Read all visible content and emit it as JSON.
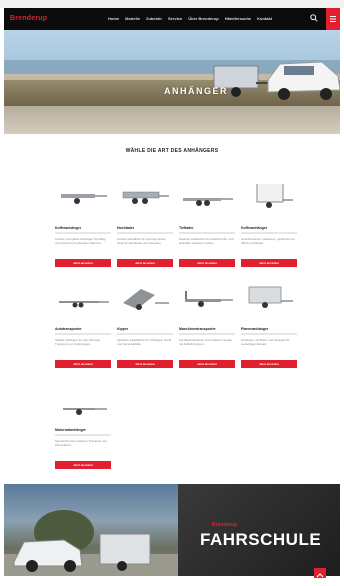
{
  "brand": {
    "name_white": "Brenderup",
    "accent": "#e0202e"
  },
  "nav": {
    "items": [
      "Home",
      "Modelle",
      "Zubehör",
      "Service",
      "Über Brenderup",
      "Händlersuche",
      "Kontakt"
    ]
  },
  "hero": {
    "title": "ANHÄNGER"
  },
  "section": {
    "title": "WÄHLE DIE ART DES ANHÄNGERS"
  },
  "cards": [
    {
      "title": "Kofferanhänger",
      "desc": "Leichte, kompakte Anhänger für Alltag und Freizeit mit robustem Rahmen.",
      "button": "Jetzt ansehen"
    },
    {
      "title": "Hochlader",
      "desc": "Große Ladefläche für sperrige Güter, ideal für Handwerk und Gewerbe.",
      "button": "Jetzt ansehen"
    },
    {
      "title": "Tieflader",
      "desc": "Niedrige Ladehöhe für einfaches Be- und Entladen schwerer Lasten.",
      "button": "Jetzt ansehen"
    },
    {
      "title": "Kofferanhänger",
      "desc": "Geschlossener Laderaum, geschützt vor Wind und Wetter.",
      "button": "Jetzt ansehen"
    },
    {
      "title": "Autotransporter",
      "desc": "Stabile Anhänger für den sicheren Transport von Fahrzeugen.",
      "button": "Jetzt ansehen"
    },
    {
      "title": "Kipper",
      "desc": "Kippbare Ladefläche für Schüttgut, Sand und Gartenabfälle.",
      "button": "Jetzt ansehen"
    },
    {
      "title": "Maschinentransporter",
      "desc": "Für Baumaschinen und schwere Geräte mit Auffahrrampen.",
      "button": "Jetzt ansehen"
    },
    {
      "title": "Planenanhänger",
      "desc": "Anhänger mit Plane und Spriegel für vielseitigen Einsatz.",
      "button": "Jetzt ansehen"
    },
    {
      "title": "Motorradanhänger",
      "desc": "Speziell für den sicheren Transport von Motorrädern.",
      "button": "Jetzt ansehen"
    }
  ],
  "banner": {
    "logo": "Brenderup",
    "title": "FAHRSCHULE"
  }
}
